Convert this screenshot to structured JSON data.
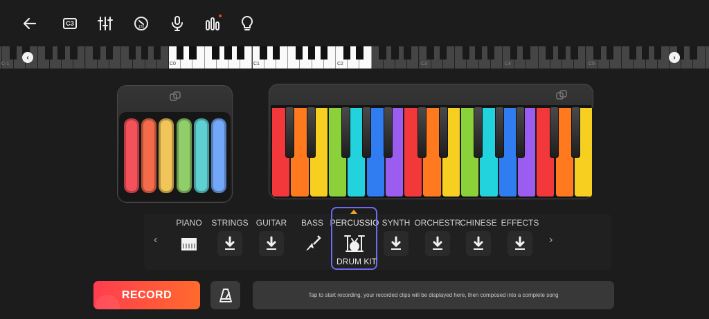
{
  "toolbar": {
    "key_badge": "C3",
    "icons": [
      "back-arrow-icon",
      "key-c3-icon",
      "mixer-sliders-icon",
      "tempo-icon",
      "microphone-icon",
      "equalizer-icon",
      "lightbulb-icon"
    ]
  },
  "keyboard_strip": {
    "labels": [
      "C-1",
      "C0",
      "C1",
      "C2",
      "C3",
      "C4",
      "C5"
    ]
  },
  "pad_colors": [
    "#f4525b",
    "#f46b4b",
    "#f2c55a",
    "#8fce6a",
    "#5fd0d2",
    "#73a8f8"
  ],
  "key_colors": [
    "#f2383a",
    "#ff7a1f",
    "#f7cf21",
    "#8ad13a",
    "#22d3dd",
    "#2f7df0",
    "#9b5cf0",
    "#f2383a",
    "#ff7a1f",
    "#f7cf21",
    "#8ad13a",
    "#22d3dd",
    "#2f7df0",
    "#9b5cf0",
    "#f2383a",
    "#ff7a1f",
    "#f7cf21"
  ],
  "instruments": [
    {
      "label": "PIANO",
      "icon": "grand-piano-icon"
    },
    {
      "label": "STRINGS",
      "icon": "download-icon"
    },
    {
      "label": "GUITAR",
      "icon": "download-icon"
    },
    {
      "label": "BASS",
      "icon": "bass-guitar-icon"
    },
    {
      "label": "PERCUSSIO",
      "icon": "drum-kit-icon",
      "selected": true,
      "sublabel": "DRUM KIT"
    },
    {
      "label": "SYNTH",
      "icon": "download-icon"
    },
    {
      "label": "ORCHESTR",
      "icon": "download-icon"
    },
    {
      "label": "CHINESE",
      "icon": "download-icon"
    },
    {
      "label": "EFFECTS",
      "icon": "download-icon"
    }
  ],
  "record": {
    "label": "RECORD",
    "hint": "Tap to start recording, your recorded clips will be displayed here, then composed into a complete song"
  },
  "colors": {
    "accent": "#6d6cf0",
    "record_start": "#ff3d4f",
    "record_end": "#ff6a2c",
    "caret": "#f5a623"
  }
}
